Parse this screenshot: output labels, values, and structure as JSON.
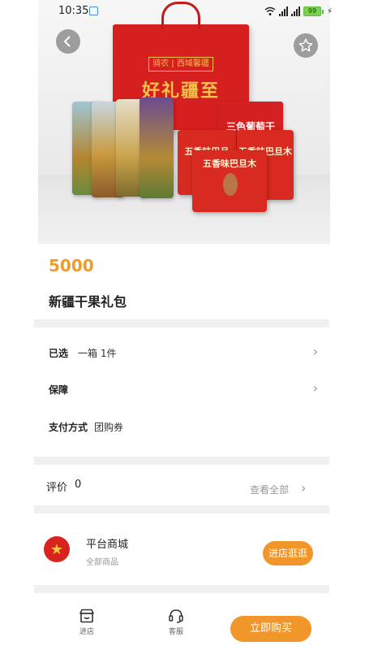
{
  "status_bar": {
    "time": "10:35",
    "battery": "99"
  },
  "product": {
    "price": "5000",
    "title": "新疆干果礼包",
    "image": {
      "bag_brand": "骑农 | 西域馨疆",
      "bag_slogan": "好礼疆至",
      "box_label": "三色葡萄干",
      "pouch_label_1": "五香味巴旦",
      "pouch_label_2": "五香味巴旦木",
      "pouch_label_3": "五香味巴旦木"
    }
  },
  "options": {
    "selected_label": "已选",
    "selected_value": "一箱 1件",
    "guarantee_label": "保障",
    "payment_label": "支付方式",
    "payment_value": "团购券"
  },
  "reviews": {
    "label": "评价",
    "count": "0",
    "view_all": "查看全部"
  },
  "store": {
    "name": "平台商城",
    "subtitle": "全部商品",
    "visit_button": "进店逛逛"
  },
  "bottom_bar": {
    "store_tab": "进店",
    "service_tab": "客服",
    "buy_button": "立即购买"
  },
  "colors": {
    "accent": "#f0962a",
    "price": "#f29a27",
    "divider": "#f0f0f0"
  }
}
